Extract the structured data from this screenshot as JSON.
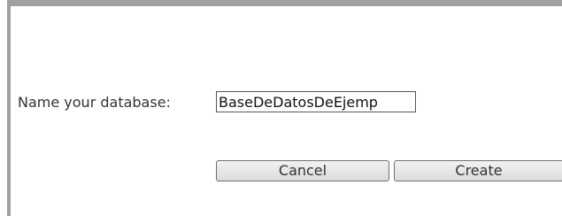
{
  "form": {
    "name_label": "Name your database:",
    "name_value": "BaseDeDatosDeEjemp",
    "cancel_label": "Cancel",
    "create_label": "Create"
  }
}
